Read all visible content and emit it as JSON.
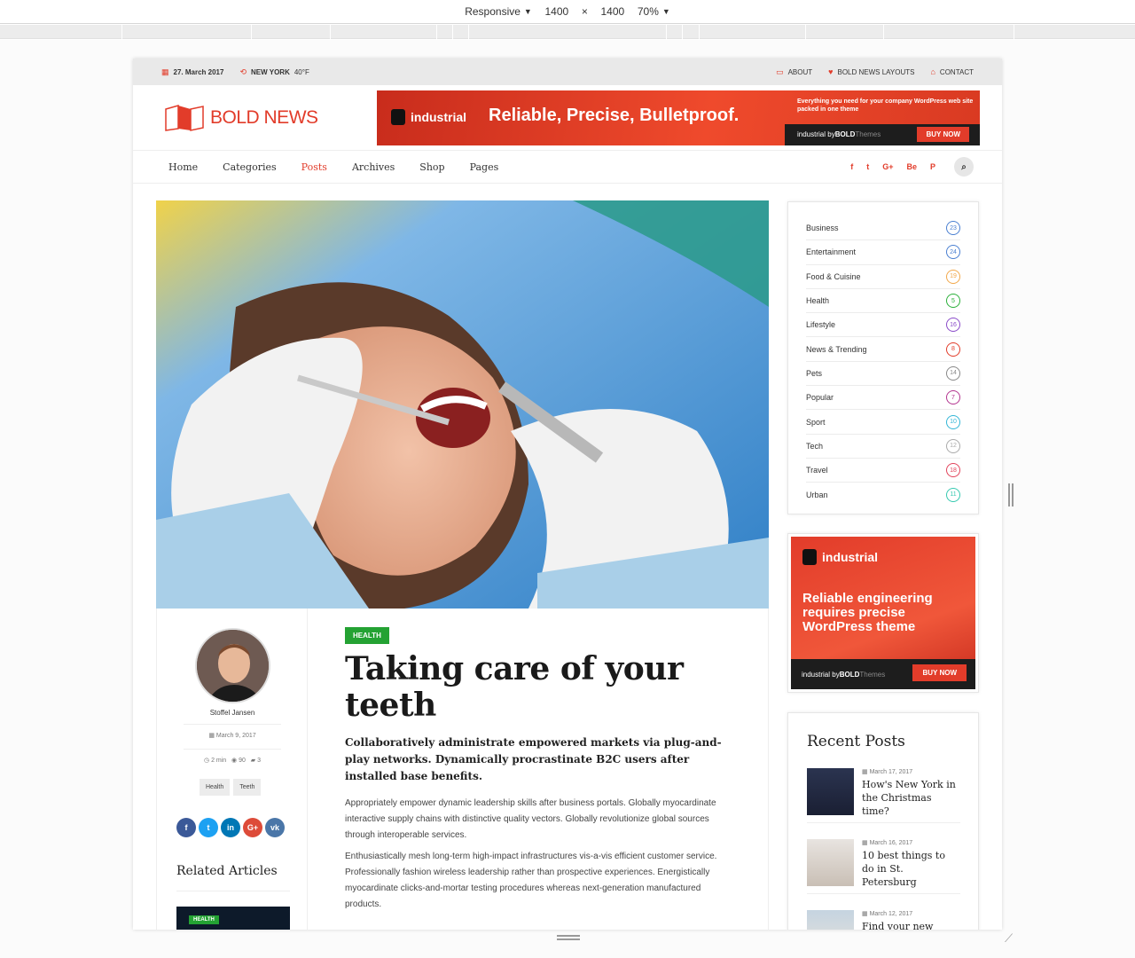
{
  "devtools": {
    "device": "Responsive",
    "width": "1400",
    "height": "1400",
    "zoom": "70%",
    "times": "×"
  },
  "topbar": {
    "date": "27. March 2017",
    "city": "NEW YORK",
    "temp": "40°F",
    "links": [
      "ABOUT",
      "BOLD NEWS LAYOUTS",
      "CONTACT"
    ]
  },
  "logo": {
    "text": "BOLD NEWS"
  },
  "banner": {
    "brand": "industrial",
    "tagline": "Reliable, Precise, Bulletproof.",
    "small": "Everything you need for your company WordPress web site packed in one theme",
    "foot_a": "industrial by ",
    "foot_b": "BOLD",
    "foot_c": "Themes",
    "buy": "BUY NOW"
  },
  "nav": {
    "items": [
      "Home",
      "Categories",
      "Posts",
      "Archives",
      "Shop",
      "Pages"
    ],
    "active": "Posts",
    "social": [
      "f",
      "t",
      "G+",
      "Be",
      "P"
    ]
  },
  "article": {
    "category": "HEALTH",
    "title": "Taking care of your teeth",
    "lead": "Collaboratively administrate empowered markets via plug-and-play networks. Dynamically procrastinate B2C users after installed base benefits.",
    "p1": "Appropriately empower dynamic leadership skills after business portals. Globally myocardinate interactive supply chains with distinctive quality vectors. Globally revolutionize global sources through interoperable services.",
    "p2": "Enthusiastically mesh long-term high-impact infrastructures vis-a-vis efficient customer service. Professionally fashion wireless leadership rather than prospective experiences. Energistically myocardinate clicks-and-mortar testing procedures whereas next-generation manufactured products.",
    "author": "Stoffel Jansen",
    "date": "March 9, 2017",
    "read_time": "2 min",
    "views": "90",
    "comments": "3",
    "tags": [
      "Health",
      "Teeth"
    ],
    "share": [
      "f",
      "t",
      "in",
      "G+",
      "vk"
    ],
    "related_title": "Related Articles",
    "related_badge": "HEALTH"
  },
  "categories": [
    {
      "name": "Business",
      "count": "23",
      "color": "#4a7fd1"
    },
    {
      "name": "Entertainment",
      "count": "24",
      "color": "#4a7fd1"
    },
    {
      "name": "Food & Cuisine",
      "count": "19",
      "color": "#f2a84b"
    },
    {
      "name": "Health",
      "count": "5",
      "color": "#2bb03a"
    },
    {
      "name": "Lifestyle",
      "count": "16",
      "color": "#8a4bc9"
    },
    {
      "name": "News & Trending",
      "count": "8",
      "color": "#e23c2a"
    },
    {
      "name": "Pets",
      "count": "14",
      "color": "#888888"
    },
    {
      "name": "Popular",
      "count": "7",
      "color": "#b3348f"
    },
    {
      "name": "Sport",
      "count": "10",
      "color": "#33b6d6"
    },
    {
      "name": "Tech",
      "count": "12",
      "color": "#aaaaaa"
    },
    {
      "name": "Travel",
      "count": "18",
      "color": "#e2445c"
    },
    {
      "name": "Urban",
      "count": "11",
      "color": "#36c9b0"
    }
  ],
  "ad": {
    "brand": "industrial",
    "text": "Reliable engineering requires precise WordPress theme",
    "foot_a": "industrial by ",
    "foot_b": "BOLD",
    "foot_c": "Themes",
    "buy": "BUY NOW"
  },
  "recent": {
    "title": "Recent Posts",
    "posts": [
      {
        "date": "March 17, 2017",
        "title": "How's New York in the Christmas time?"
      },
      {
        "date": "March 16, 2017",
        "title": "10 best things to do in St. Petersburg"
      },
      {
        "date": "March 12, 2017",
        "title": "Find your new apartment with just"
      }
    ]
  },
  "colors": {
    "accent": "#e23c2a",
    "health": "#24a233"
  }
}
